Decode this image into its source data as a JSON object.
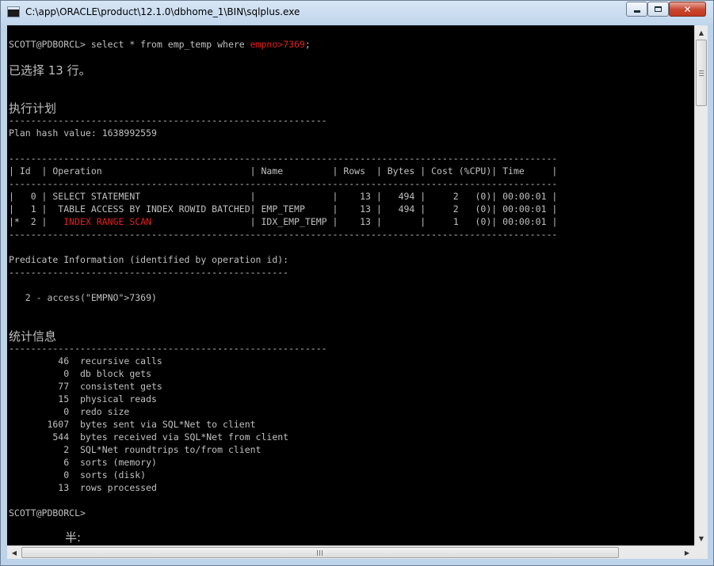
{
  "window": {
    "title": "C:\\app\\ORACLE\\product\\12.1.0\\dbhome_1\\BIN\\sqlplus.exe",
    "close_glyph": "✕"
  },
  "console": {
    "prompt": "SCOTT@PDBORCL> ",
    "query_text": "select * from emp_temp where ",
    "query_highlight": "empno>7369",
    "query_end": ";",
    "rows_selected": "已选择 13 行。",
    "exec_plan_heading": "执行计划",
    "dash_long": "----------------------------------------------------------",
    "plan_hash": "Plan hash value: 1638992559",
    "dash_table": "----------------------------------------------------------------------------------------------------",
    "table_header": "| Id  | Operation                           | Name         | Rows  | Bytes | Cost (%CPU)| Time     |",
    "row0": "|   0 | SELECT STATEMENT                    |              |    13 |   494 |     2   (0)| 00:00:01 |",
    "row1": "|   1 |  TABLE ACCESS BY INDEX ROWID BATCHED| EMP_TEMP     |    13 |   494 |     2   (0)| 00:00:01 |",
    "row2_prefix": "|*  2 |   ",
    "row2_op": "INDEX RANGE SCAN",
    "row2_suffix": "                  | IDX_EMP_TEMP |    13 |       |     1   (0)| 00:00:01 |",
    "predicate_heading": "Predicate Information (identified by operation id):",
    "dash_predicate": "---------------------------------------------------",
    "predicate_line": "   2 - access(\"EMPNO\">7369)",
    "stats_heading": "统计信息",
    "stats": [
      "         46  recursive calls",
      "          0  db block gets",
      "         77  consistent gets",
      "         15  physical reads",
      "          0  redo size",
      "       1607  bytes sent via SQL*Net to client",
      "        544  bytes received via SQL*Net from client",
      "          2  SQL*Net roundtrips to/from client",
      "          6  sorts (memory)",
      "          0  sorts (disk)",
      "         13  rows processed"
    ],
    "final_prompt": "SCOTT@PDBORCL>",
    "ime_text": "半:"
  },
  "scrollbars": {
    "up_glyph": "▲",
    "down_glyph": "▼",
    "left_glyph": "◀",
    "right_glyph": "▶"
  }
}
